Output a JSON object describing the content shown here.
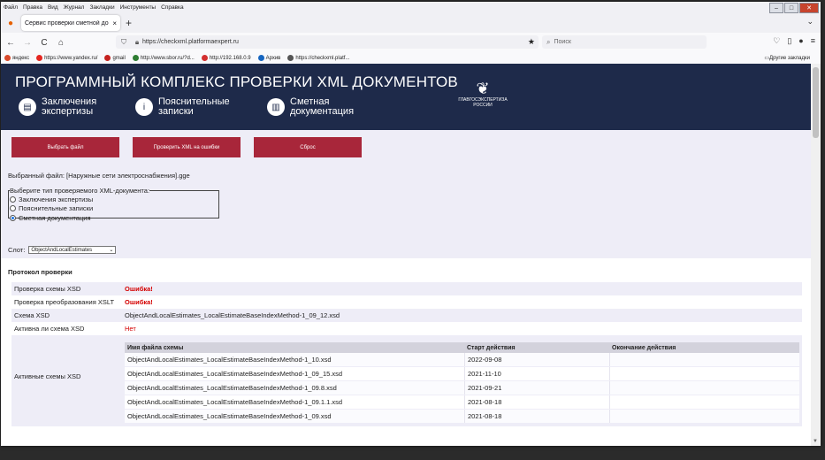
{
  "menu": [
    "Файл",
    "Правка",
    "Вид",
    "Журнал",
    "Закладки",
    "Инструменты",
    "Справка"
  ],
  "tab": {
    "title": "Сервис проверки сметной докуме",
    "close": "×",
    "new": "+"
  },
  "nav": {
    "back": "←",
    "forward": "→",
    "reload": "C",
    "home": "⌂",
    "url": "https://checkxml.platformaexpert.ru",
    "search_placeholder": "Поиск"
  },
  "bookmarks": [
    {
      "label": "яндекс",
      "color": "#d94a2b"
    },
    {
      "label": "https://www.yandex.ru/",
      "color": "#e52620"
    },
    {
      "label": "gmail",
      "color": "#c5221f"
    },
    {
      "label": "http://www.sbor.ru/?d...",
      "color": "#2e7d32"
    },
    {
      "label": "http://192.168.0.9",
      "color": "#d32f2f"
    },
    {
      "label": "Архив",
      "color": "#1565c0"
    },
    {
      "label": "https://checkxml.platf...",
      "color": "#555555"
    }
  ],
  "bookmarks_other": "Другие закладки",
  "banner": {
    "title": "ПРОГРАММНЫЙ КОМПЛЕКС ПРОВЕРКИ XML ДОКУМЕНТОВ",
    "items": [
      {
        "label": "Заключения\nэкспертизы",
        "icon": "▤"
      },
      {
        "label": "Пояснительные\nзаписки",
        "icon": "i"
      },
      {
        "label": "Сметная\nдокументация",
        "icon": "▥"
      }
    ],
    "logo_line1": "ГЛАВГОСЭКСПЕРТИЗА",
    "logo_line2": "РОССИИ"
  },
  "buttons": {
    "choose": "Выбрать файл",
    "check": "Проверить XML на ошибки",
    "reset": "Сброс"
  },
  "selected_file": "Выбранный файл:  [Наружные сети электроснабжения].gge",
  "xml_type": {
    "legend": "Выберите тип проверяемого XML-документа:",
    "options": [
      "Заключения экспертизы",
      "Пояснительные записки",
      "Сметная документация"
    ],
    "selected_index": 2
  },
  "slot": {
    "label": "Слот:",
    "value": "ObjectAndLocalEstimates"
  },
  "protocol": {
    "title": "Протокол проверки",
    "rows": [
      {
        "key": "Проверка схемы XSD",
        "value": "Ошибка!"
      },
      {
        "key": "Проверка преобразования XSLT",
        "value": "Ошибка!"
      },
      {
        "key": "Схема XSD",
        "value": "ObjectAndLocalEstimates_LocalEstimateBaseIndexMethod-1_09_12.xsd"
      },
      {
        "key": "Активна ли схема XSD",
        "value": "Нет"
      }
    ],
    "active_label": "Активные схемы XSD",
    "headers": [
      "Имя файла схемы",
      "Старт действия",
      "Окончание действия"
    ],
    "schemas": [
      [
        "ObjectAndLocalEstimates_LocalEstimateBaseIndexMethod-1_10.xsd",
        "2022-09-08",
        ""
      ],
      [
        "ObjectAndLocalEstimates_LocalEstimateBaseIndexMethod-1_09_15.xsd",
        "2021-11-10",
        ""
      ],
      [
        "ObjectAndLocalEstimates_LocalEstimateBaseIndexMethod-1_09.8.xsd",
        "2021-09-21",
        ""
      ],
      [
        "ObjectAndLocalEstimates_LocalEstimateBaseIndexMethod-1_09.1.1.xsd",
        "2021-08-18",
        ""
      ],
      [
        "ObjectAndLocalEstimates_LocalEstimateBaseIndexMethod-1_09.xsd",
        "2021-08-18",
        ""
      ]
    ]
  }
}
